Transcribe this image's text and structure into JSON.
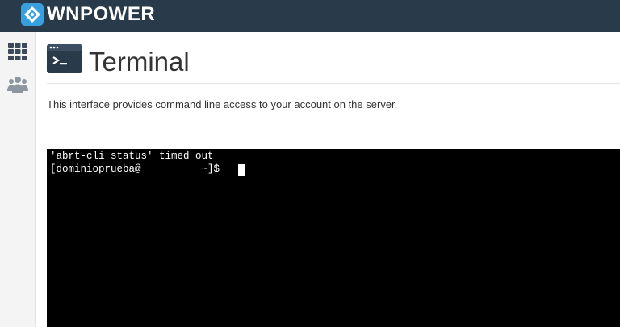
{
  "header": {
    "brand_name": "WNPOWER",
    "logo_icon": "wnpower-logo-icon",
    "background_color": "#293a4a"
  },
  "sidebar": {
    "items": [
      {
        "icon": "apps-grid-icon"
      },
      {
        "icon": "users-icon"
      }
    ]
  },
  "page": {
    "title": "Terminal",
    "title_icon": "terminal-icon",
    "description": "This interface provides command line access to your account on the server."
  },
  "terminal": {
    "background_color": "#000000",
    "text_color": "#ffffff",
    "lines": [
      "'abrt-cli status' timed out",
      "[dominioprueba@          ~]$ "
    ]
  }
}
